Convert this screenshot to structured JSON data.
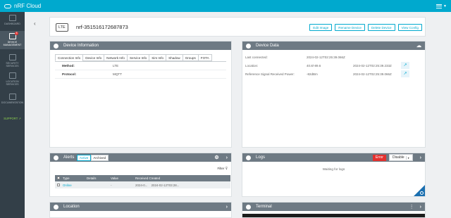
{
  "topbar": {
    "title": "nRF Cloud"
  },
  "sidebar": {
    "items": [
      {
        "label": "DASHBOARD"
      },
      {
        "label": "DEVICE MANAGEMENT",
        "badge": "8"
      },
      {
        "label": "SECURITY SERVICES"
      },
      {
        "label": "LOCATION SERVICES"
      },
      {
        "label": "DOCUMENTATION"
      },
      {
        "label": "SUPPORT"
      }
    ]
  },
  "device": {
    "badge": "LTE",
    "id": "nrf-351516172687873",
    "actions": [
      "Edit Image",
      "Rename Device",
      "Delete Device",
      "View Config"
    ]
  },
  "device_info": {
    "title": "Device Information",
    "tabs": [
      "Connection Info",
      "Device Info",
      "Network Info",
      "Service Info",
      "Sim Info",
      "Shadow",
      "Groups",
      "FOTA"
    ],
    "rows": [
      {
        "key": "Method:",
        "value": "LTE"
      },
      {
        "key": "Protocol:",
        "value": "MQTT"
      }
    ]
  },
  "device_data": {
    "title": "Device Data",
    "rows": [
      {
        "label": "Last connected:",
        "value": "2024-02-12T02:25:39.066Z",
        "time": ""
      },
      {
        "label": "Location:",
        "value": "40.8/-89.6",
        "time": "2024-02-12T02:25:39.233Z"
      },
      {
        "label": "Reference Signal Received Power:",
        "value": "-82dBm",
        "time": "2024-02-12T02:25:39.066Z"
      }
    ]
  },
  "alerts": {
    "title": "Alerts",
    "segments": [
      "Active",
      "Archived"
    ],
    "filter": "Filter",
    "columns": [
      "Type",
      "Details",
      "Value",
      "Received Created"
    ],
    "rows": [
      {
        "type": "Online",
        "details": "",
        "value": "-",
        "received": "2024-0...",
        "created": "2024-02-12T03:28..."
      }
    ]
  },
  "logs": {
    "title": "Logs",
    "error_label": "Error",
    "disable_label": "Disable",
    "waiting": "Waiting for logs"
  },
  "location": {
    "title": "Location"
  },
  "terminal": {
    "title": "Terminal"
  },
  "colors": {
    "brand": "#00a9ce",
    "sidebar": "#333f48",
    "panel_header": "#6e7a84",
    "error": "#e4312f"
  }
}
